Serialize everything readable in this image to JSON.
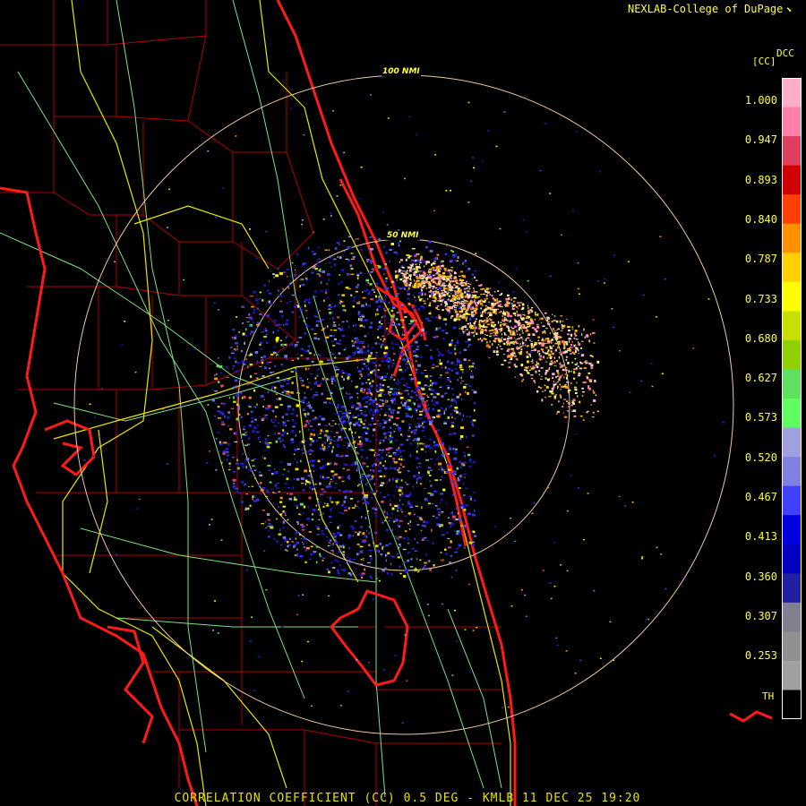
{
  "header": {
    "credit": "NEXLAB-College of DuPage",
    "credit_icon": "corner-flag-icon"
  },
  "map": {
    "radar_site": "KMLB",
    "range_rings": [
      {
        "label": "100 NMI"
      },
      {
        "label": "50 NMI"
      }
    ],
    "colors": {
      "background": "#000000",
      "coastline": "#ff1a1a",
      "county_lines": "#b00000",
      "highways": "#e8e800",
      "roads": "#7fe27f",
      "range_ring": "#f0c8a0"
    }
  },
  "legend": {
    "product_code": "DCC",
    "unit": "[CC]",
    "ticks": [
      "1.000",
      "0.947",
      "0.893",
      "0.840",
      "0.787",
      "0.733",
      "0.680",
      "0.627",
      "0.573",
      "0.520",
      "0.467",
      "0.413",
      "0.360",
      "0.307",
      "0.253"
    ],
    "threshold_label": "TH",
    "colors": [
      "#ffb0c8",
      "#ff80a8",
      "#e04060",
      "#d00000",
      "#ff4000",
      "#ff9000",
      "#ffd000",
      "#ffff00",
      "#c8e000",
      "#90d000",
      "#60e060",
      "#60ff60",
      "#a0a0e0",
      "#8080e0",
      "#4040ff",
      "#0000e0",
      "#0000c0",
      "#2020a0",
      "#808090",
      "#909090",
      "#a0a0a0",
      "#000000"
    ]
  },
  "footer": {
    "caption": "CORRELATION COEFFICIENT (CC) 0.5 DEG - KMLB 11 DEC 25 19:20"
  }
}
